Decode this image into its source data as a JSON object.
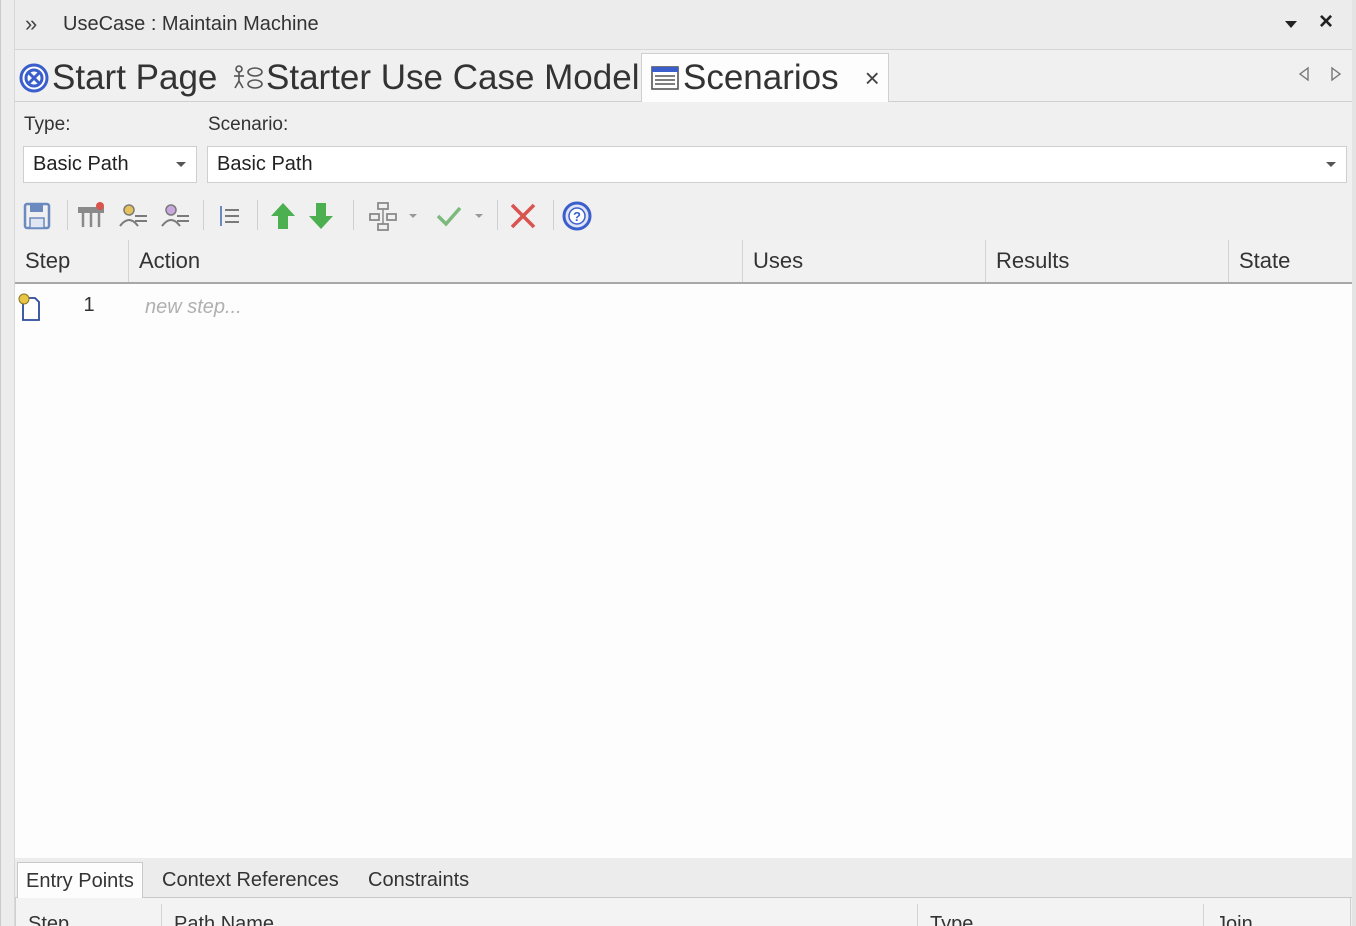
{
  "window": {
    "title": "UseCase : Maintain Machine"
  },
  "tabs": [
    {
      "label": "Start Page",
      "icon": "start-page-icon"
    },
    {
      "label": "Starter Use Case Model",
      "icon": "use-case-model-icon"
    },
    {
      "label": "Scenarios",
      "icon": "scenarios-icon",
      "active": true
    }
  ],
  "form": {
    "type_label": "Type:",
    "type_value": "Basic Path",
    "scenario_label": "Scenario:",
    "scenario_value": "Basic Path"
  },
  "toolbar": {
    "icons": [
      "save-icon",
      "new-step-icon",
      "actor-step-icon",
      "system-step-icon",
      "indent-icon",
      "move-up-icon",
      "move-down-icon",
      "structure-icon",
      "check-icon",
      "delete-icon",
      "help-icon"
    ]
  },
  "grid": {
    "columns": [
      "Step",
      "Action",
      "Uses",
      "Results",
      "State"
    ],
    "rows": [
      {
        "step": "1",
        "action_placeholder": "new step..."
      }
    ]
  },
  "bottom_tabs": [
    "Entry Points",
    "Context References",
    "Constraints"
  ],
  "bottom_grid": {
    "columns": [
      "Step",
      "Path Name",
      "Type",
      "Join"
    ]
  },
  "colors": {
    "accent_blue": "#3a5fcd",
    "green_arrow": "#4caf50",
    "delete_red": "#d9534f"
  }
}
